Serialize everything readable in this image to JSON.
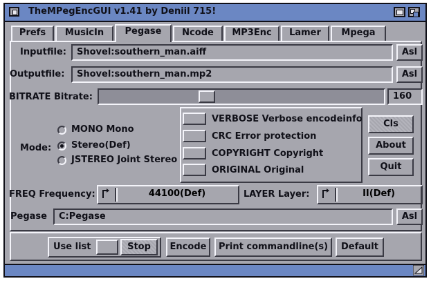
{
  "window": {
    "title": "TheMPegEncGUI v1.41 by Deniil 715!"
  },
  "tabs": [
    {
      "label": "Prefs"
    },
    {
      "label": "MusicIn"
    },
    {
      "label": "Pegase",
      "active": true
    },
    {
      "label": "Ncode"
    },
    {
      "label": "MP3Enc"
    },
    {
      "label": "Lamer"
    },
    {
      "label": "Mpega"
    }
  ],
  "inputfile": {
    "label": "Inputfile:",
    "value": "Shovel:southern_man.aiff",
    "button": "Asl"
  },
  "outputfile": {
    "label": "Outputfile:",
    "value": "Shovel:southern_man.mp2",
    "button": "Asl"
  },
  "bitrate": {
    "label": "BITRATE Bitrate:",
    "value": "160",
    "slider_fraction": 0.37
  },
  "mode": {
    "label": "Mode:",
    "options": [
      "MONO Mono",
      "Stereo(Def)",
      "JSTEREO Joint Stereo"
    ],
    "selected_index": 1
  },
  "flags": [
    "VERBOSE Verbose encodeinfo",
    "CRC Error protection",
    "COPYRIGHT Copyright",
    "ORIGINAL Original"
  ],
  "side_buttons": {
    "cls": "Cls",
    "about": "About",
    "quit": "Quit"
  },
  "freq": {
    "label": "FREQ Frequency:",
    "value": "44100(Def)"
  },
  "layer": {
    "label": "LAYER Layer:",
    "value": "II(Def)"
  },
  "pegase": {
    "label": "Pegase",
    "value": "C:Pegase",
    "button": "Asl"
  },
  "bottom": {
    "use_list": "Use list",
    "stop": "Stop",
    "encode": "Encode",
    "print": "Print commandline(s)",
    "default": "Default"
  },
  "colors": {
    "face": "#a6a6ae",
    "title_bar": "#6b87c3",
    "shine": "#f4f4fa",
    "shadow": "#3a3a44"
  },
  "icons": {
    "close": "close-gadget-icon",
    "zoom": "zoom-gadget-icon",
    "depth": "depth-gadget-icon",
    "cycle": "cycle-arrow-icon",
    "resize": "resize-corner-icon"
  }
}
